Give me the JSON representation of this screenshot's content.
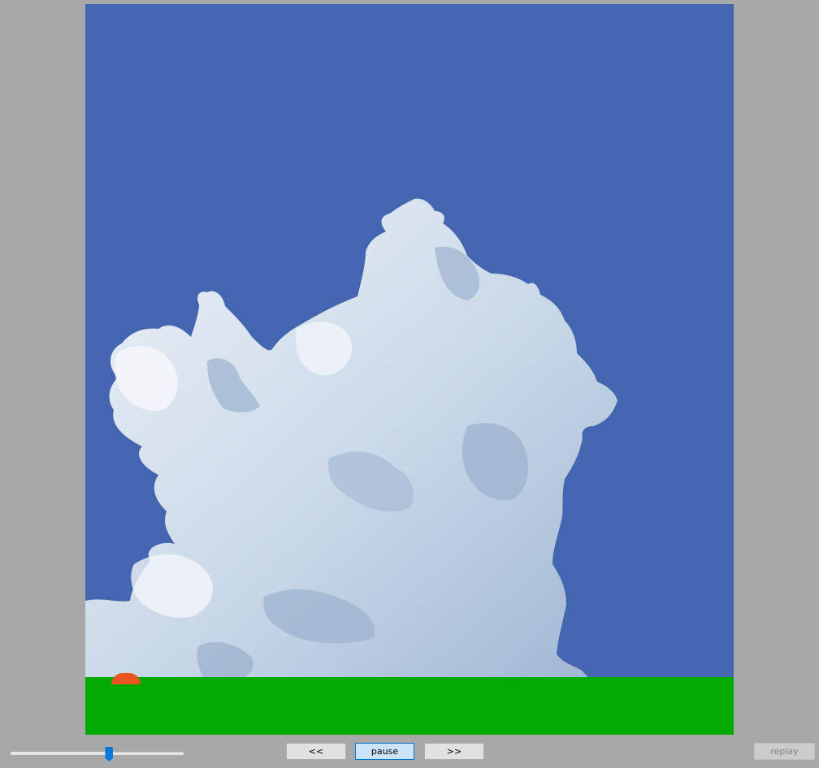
{
  "scene": {
    "sky_color": "#4466b0",
    "ground_color": "#00aa00",
    "player_color": "#e8541e",
    "cloud_color": "#e4ecf4"
  },
  "controls": {
    "slider": {
      "value": 0.57
    },
    "prev_label": "<<",
    "pause_label": "pause",
    "next_label": ">>",
    "replay_label": "replay"
  }
}
